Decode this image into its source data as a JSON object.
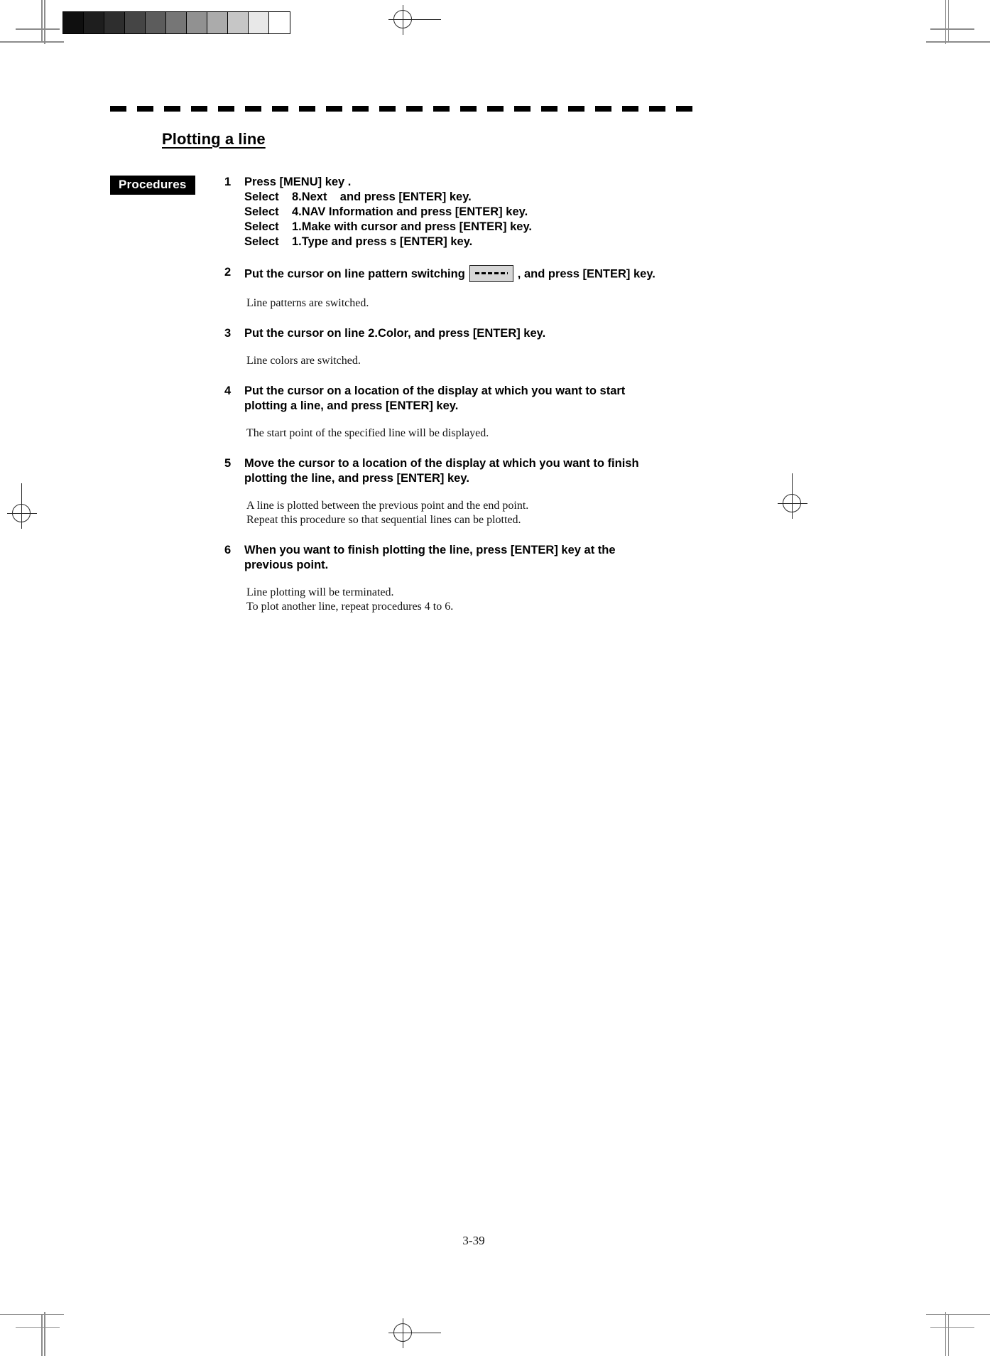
{
  "document": {
    "title": "Plotting a line",
    "page_number": "3-39",
    "procedures_label": "Procedures"
  },
  "calibration": {
    "name": "grayscale-step-wedge",
    "swatches": [
      "#0f0f0f",
      "#1e1e1e",
      "#2e2e2e",
      "#454545",
      "#5c5c5c",
      "#767676",
      "#919191",
      "#ababab",
      "#c6c6c6",
      "#e8e8e8",
      "#ffffff"
    ]
  },
  "steps": [
    {
      "number": "1",
      "lines": [
        "Press [MENU] key .",
        "Select    8.Next    and press [ENTER] key.",
        "Select    4.NAV Information and press [ENTER] key.",
        "Select    1.Make with cursor and press [ENTER] key.",
        "Select    1.Type and press s [ENTER] key."
      ],
      "notes": []
    },
    {
      "number": "2",
      "text_before": "Put the cursor on line pattern switching",
      "pattern_swatch": "--------",
      "text_after": ", and press [ENTER] key.",
      "notes": [
        "Line patterns are switched."
      ]
    },
    {
      "number": "3",
      "lines": [
        "Put the cursor on line 2.Color, and press [ENTER] key."
      ],
      "notes": [
        "Line colors are switched."
      ]
    },
    {
      "number": "4",
      "lines": [
        "Put the cursor on a location of the display at which you want to start",
        "plotting a line, and press [ENTER] key."
      ],
      "notes": [
        "The start point of the specified line will be displayed."
      ]
    },
    {
      "number": "5",
      "lines": [
        "Move the cursor to a location of the display at which you want to finish",
        "plotting the line, and press [ENTER] key."
      ],
      "notes": [
        "A line is plotted between the previous point and the end point.",
        "Repeat this procedure so that sequential lines can be plotted."
      ]
    },
    {
      "number": "6",
      "lines": [
        "When you want to finish plotting the line, press [ENTER] key at the",
        "previous point."
      ],
      "notes": [
        "Line plotting will be terminated.",
        "To plot another line, repeat procedures 4 to 6."
      ]
    }
  ]
}
